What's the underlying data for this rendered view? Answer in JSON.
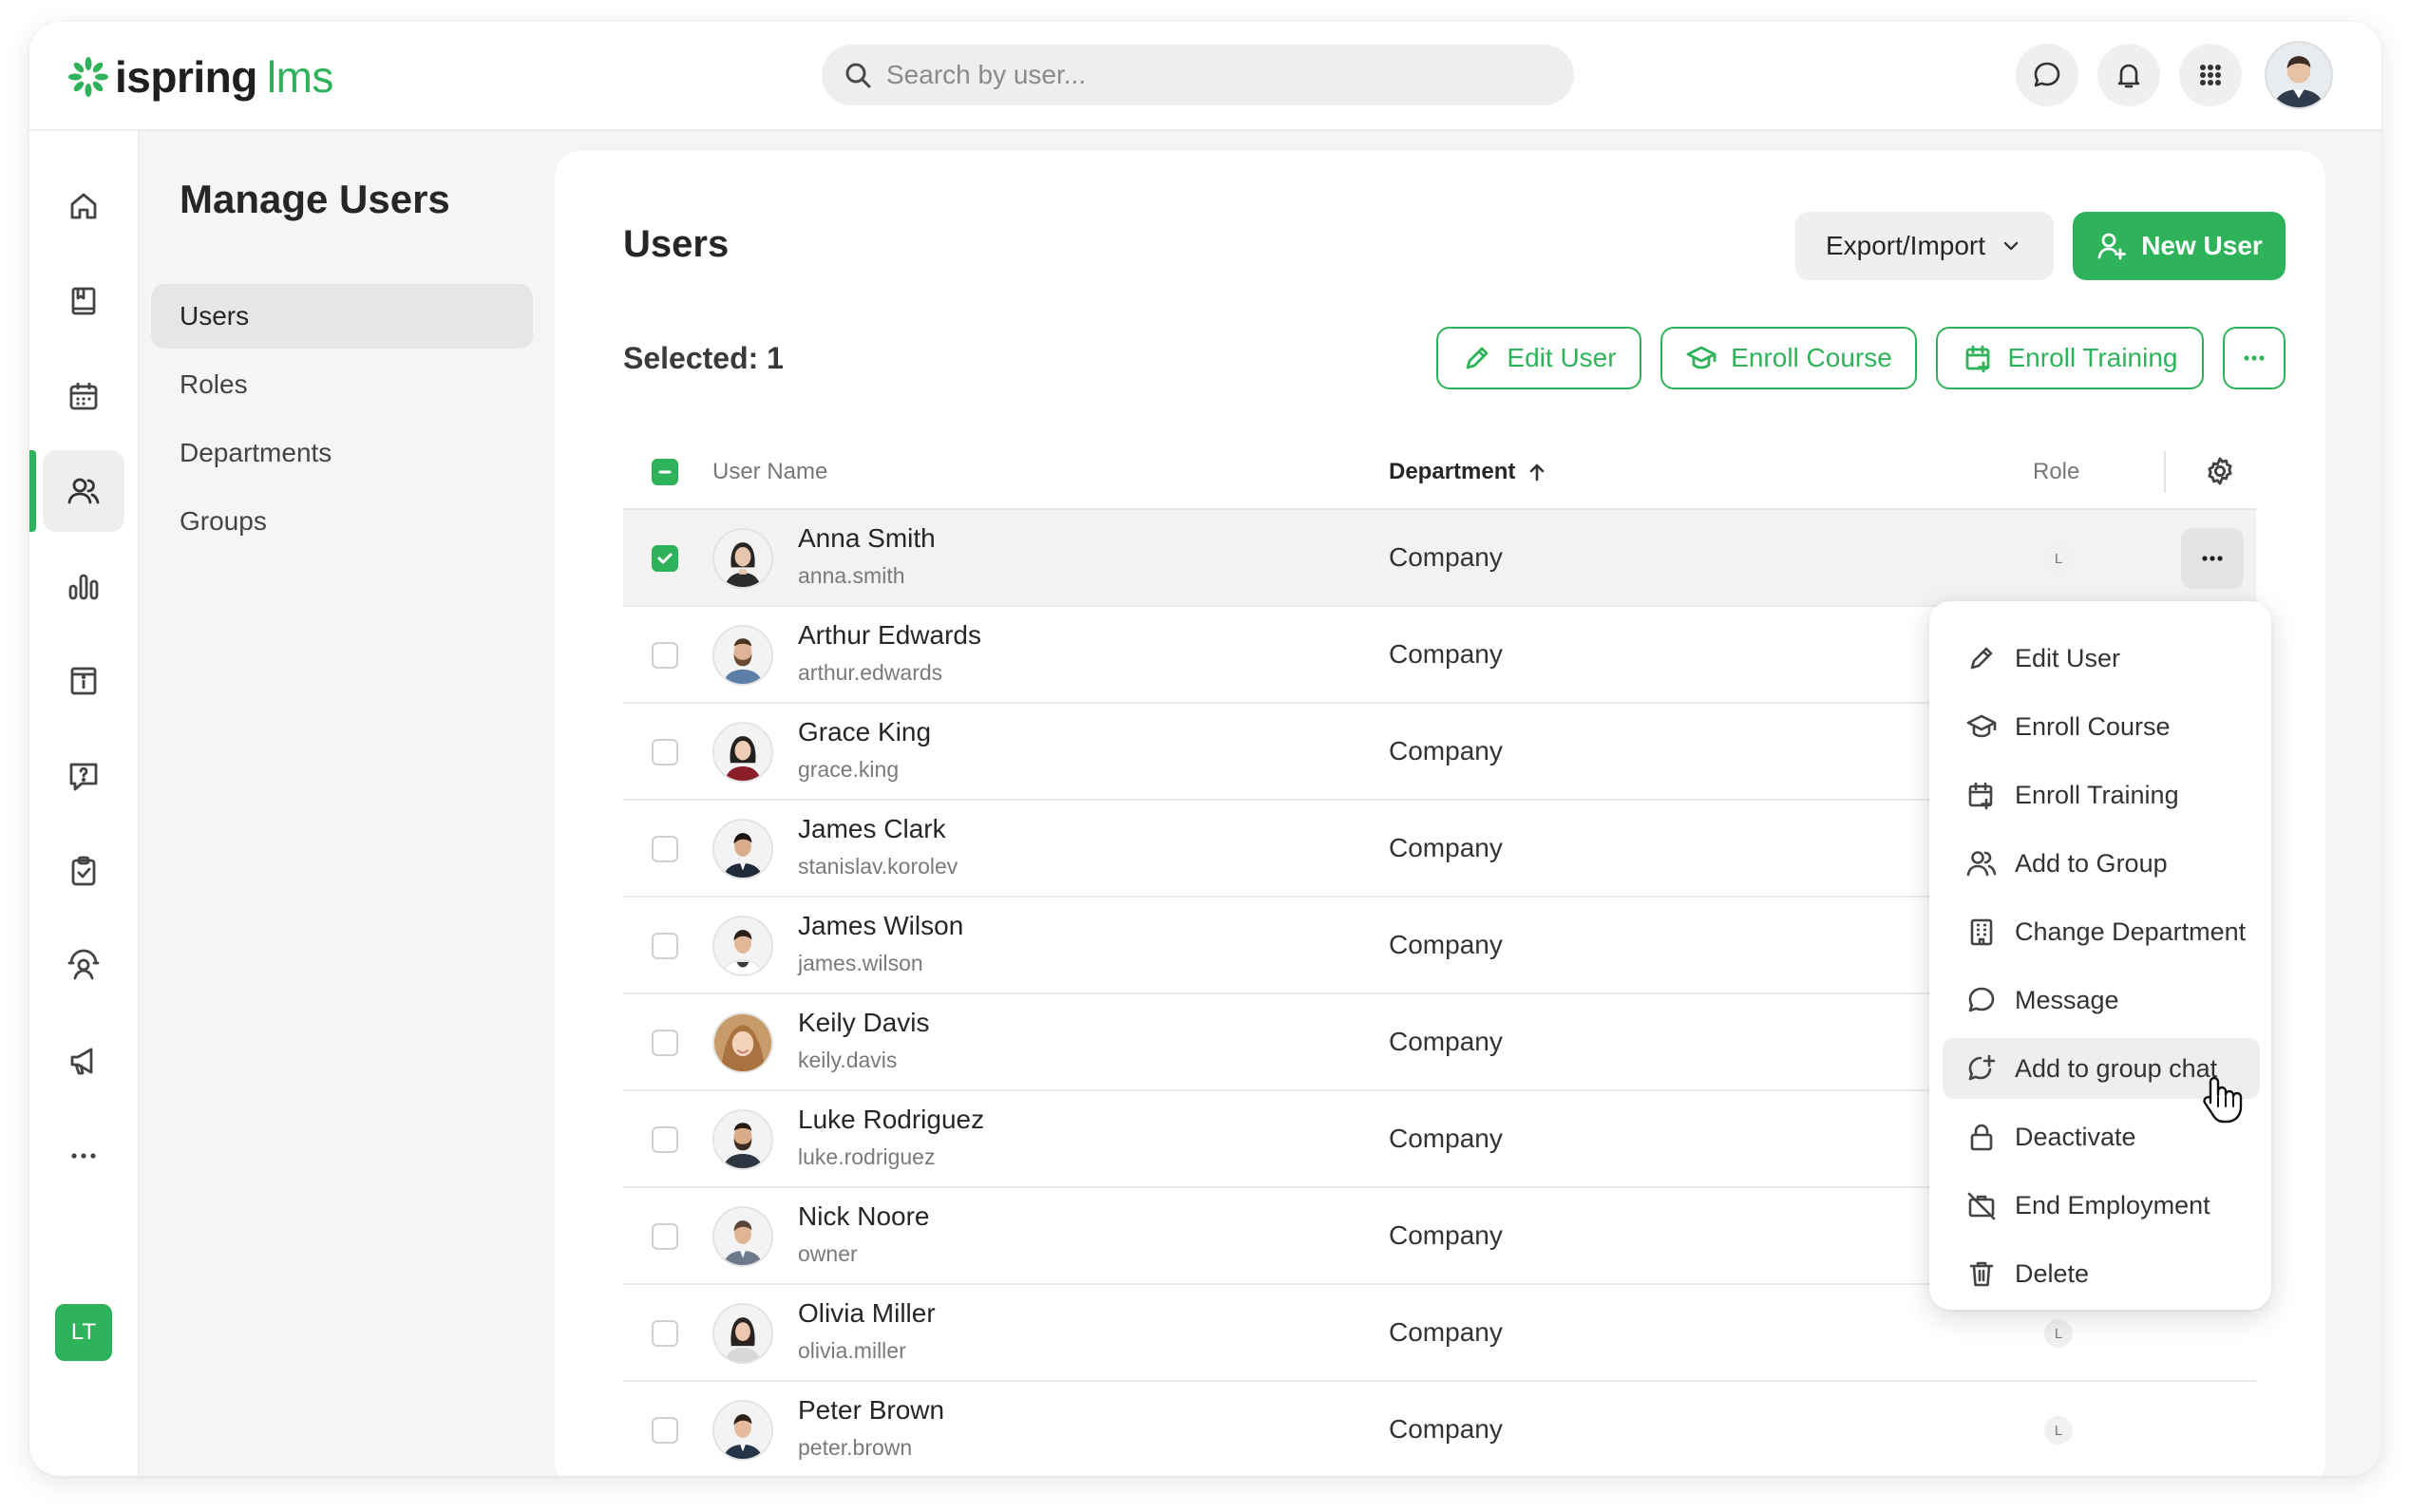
{
  "brand": {
    "name": "ispring",
    "product": "lms",
    "accent_color": "#2fb35a"
  },
  "header": {
    "search": {
      "placeholder": "Search by user..."
    },
    "icons": [
      "chat-icon",
      "bell-icon",
      "apps-grid-icon",
      "user-avatar"
    ]
  },
  "rail": {
    "items": [
      "home-icon",
      "library-icon",
      "calendar-icon",
      "users-icon",
      "reports-icon",
      "info-board-icon",
      "question-icon",
      "assignments-icon",
      "coaching-icon",
      "announcements-icon",
      "more-icon"
    ],
    "active": "users-icon",
    "bottom_icon": "add-widget-icon",
    "badge": "LT"
  },
  "subnav": {
    "title": "Manage Users",
    "items": [
      {
        "label": "Users",
        "active": true
      },
      {
        "label": "Roles",
        "active": false
      },
      {
        "label": "Departments",
        "active": false
      },
      {
        "label": "Groups",
        "active": false
      }
    ]
  },
  "main": {
    "title": "Users",
    "export_import_label": "Export/Import",
    "new_user_label": "New User",
    "selected_text": "Selected: 1",
    "actions": {
      "edit_user": "Edit User",
      "enroll_course": "Enroll Course",
      "enroll_training": "Enroll Training"
    }
  },
  "table": {
    "columns": {
      "user_name": "User Name",
      "department": "Department",
      "role": "Role"
    },
    "sort": {
      "column": "Department",
      "direction": "ascending"
    },
    "rows": [
      {
        "name": "Anna Smith",
        "login": "anna.smith",
        "department": "Company",
        "role": "L",
        "checked": true
      },
      {
        "name": "Arthur Edwards",
        "login": "arthur.edwards",
        "department": "Company",
        "role": "",
        "checked": false
      },
      {
        "name": "Grace King",
        "login": "grace.king",
        "department": "Company",
        "role": "",
        "checked": false
      },
      {
        "name": "James Clark",
        "login": "stanislav.korolev",
        "department": "Company",
        "role": "",
        "checked": false
      },
      {
        "name": "James Wilson",
        "login": "james.wilson",
        "department": "Company",
        "role": "",
        "checked": false
      },
      {
        "name": "Keily Davis",
        "login": "keily.davis",
        "department": "Company",
        "role": "",
        "checked": false
      },
      {
        "name": "Luke Rodriguez",
        "login": "luke.rodriguez",
        "department": "Company",
        "role": "",
        "checked": false
      },
      {
        "name": "Nick Noore",
        "login": "owner",
        "department": "Company",
        "role": "",
        "checked": false
      },
      {
        "name": "Olivia Miller",
        "login": "olivia.miller",
        "department": "Company",
        "role": "L",
        "checked": false
      },
      {
        "name": "Peter Brown",
        "login": "peter.brown",
        "department": "Company",
        "role": "L",
        "checked": false
      }
    ]
  },
  "context_menu": {
    "items": [
      {
        "label": "Edit User",
        "icon": "pencil-icon"
      },
      {
        "label": "Enroll Course",
        "icon": "graduation-cap-icon"
      },
      {
        "label": "Enroll Training",
        "icon": "calendar-plus-icon"
      },
      {
        "label": "Add to Group",
        "icon": "users-icon"
      },
      {
        "label": "Change Department",
        "icon": "building-icon"
      },
      {
        "label": "Message",
        "icon": "chat-icon"
      },
      {
        "label": "Add to group chat",
        "icon": "chat-plus-icon",
        "hovered": true
      },
      {
        "label": "Deactivate",
        "icon": "lock-icon"
      },
      {
        "label": "End Employment",
        "icon": "briefcase-off-icon"
      },
      {
        "label": "Delete",
        "icon": "trash-icon"
      }
    ]
  }
}
